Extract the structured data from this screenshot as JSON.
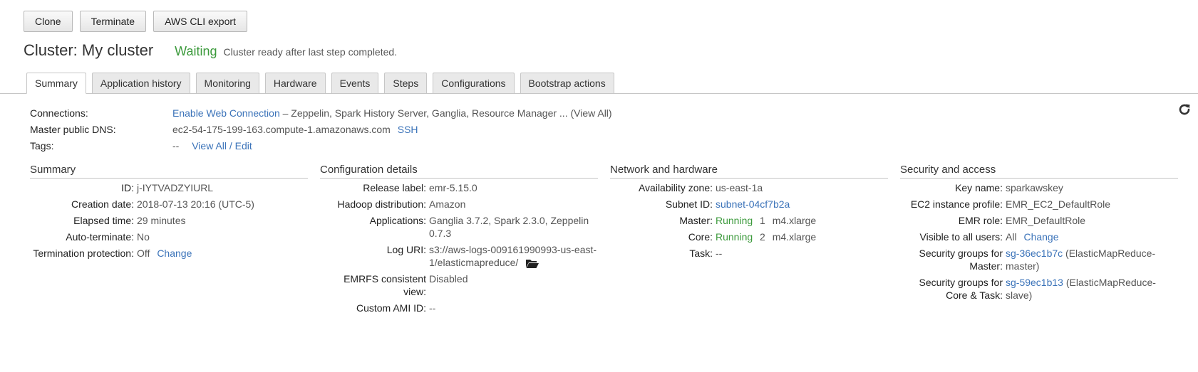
{
  "toolbar": {
    "clone": "Clone",
    "terminate": "Terminate",
    "export": "AWS CLI export"
  },
  "header": {
    "title": "Cluster: My cluster",
    "state": "Waiting",
    "state_message": "Cluster ready after last step completed."
  },
  "tabs": [
    "Summary",
    "Application history",
    "Monitoring",
    "Hardware",
    "Events",
    "Steps",
    "Configurations",
    "Bootstrap actions"
  ],
  "connections": {
    "label": "Connections:",
    "link": "Enable Web Connection",
    "services": " – Zeppelin, Spark History Server, Ganglia, Resource Manager ... ",
    "view_all": "(View All)"
  },
  "master_dns": {
    "label": "Master public DNS:",
    "value": "ec2-54-175-199-163.compute-1.amazonaws.com",
    "ssh": "SSH"
  },
  "tags": {
    "label": "Tags:",
    "value": "--",
    "link": "View All / Edit"
  },
  "summary": {
    "title": "Summary",
    "id_label": "ID:",
    "id": "j-IYTVADZYIURL",
    "creation_label": "Creation date:",
    "creation": "2018-07-13 20:16 (UTC-5)",
    "elapsed_label": "Elapsed time:",
    "elapsed": "29 minutes",
    "autoterm_label": "Auto-terminate:",
    "autoterm": "No",
    "termprot_label": "Termination protection:",
    "termprot": "Off",
    "termprot_change": "Change"
  },
  "config": {
    "title": "Configuration details",
    "release_label": "Release label:",
    "release": "emr-5.15.0",
    "hadoop_label": "Hadoop distribution:",
    "hadoop": "Amazon",
    "apps_label": "Applications:",
    "apps": "Ganglia 3.7.2, Spark 2.3.0, Zeppelin 0.7.3",
    "log_label": "Log URI:",
    "log": "s3://aws-logs-009161990993-us-east-1/elasticmapreduce/",
    "emrfs_label": "EMRFS consistent view:",
    "emrfs": "Disabled",
    "ami_label": "Custom AMI ID:",
    "ami": "--"
  },
  "network": {
    "title": "Network and hardware",
    "az_label": "Availability zone:",
    "az": "us-east-1a",
    "subnet_label": "Subnet ID:",
    "subnet": "subnet-04cf7b2a",
    "master_label": "Master:",
    "master_status": "Running",
    "master_count": "1",
    "master_type": "m4.xlarge",
    "core_label": "Core:",
    "core_status": "Running",
    "core_count": "2",
    "core_type": "m4.xlarge",
    "task_label": "Task:",
    "task": "--"
  },
  "security": {
    "title": "Security and access",
    "key_label": "Key name:",
    "key": "sparkawskey",
    "ec2_label": "EC2 instance profile:",
    "ec2": "EMR_EC2_DefaultRole",
    "emr_label": "EMR role:",
    "emr": "EMR_DefaultRole",
    "visible_label": "Visible to all users:",
    "visible": "All",
    "visible_change": "Change",
    "sg_master_label": "Security groups for Master:",
    "sg_master": "sg-36ec1b7c",
    "sg_master_desc": " (ElasticMapReduce-master)",
    "sg_core_label": "Security groups for Core & Task:",
    "sg_core": "sg-59ec1b13",
    "sg_core_desc": " (ElasticMapReduce-slave)"
  },
  "colors": {
    "link": "#3b73b9",
    "running": "#3c9a3c"
  },
  "icons": {
    "refresh": "refresh-icon",
    "folder": "folder-open-icon"
  }
}
